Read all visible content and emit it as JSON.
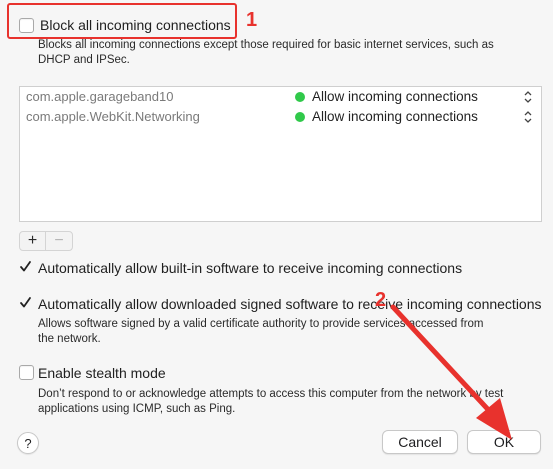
{
  "block_incoming": {
    "label": "Block all incoming connections",
    "checked": false,
    "description_line1": "Blocks all incoming connections except those required for basic internet services, such as",
    "description_line2": "DHCP and IPSec."
  },
  "annotations": {
    "marker1": "1",
    "marker2": "2",
    "color": "#e8322d"
  },
  "apps": [
    {
      "name": "com.apple.garageband10",
      "status": "Allow incoming connections",
      "status_color": "#30c94a",
      "stepper": "⌃⌄"
    },
    {
      "name": "com.apple.WebKit.Networking",
      "status": "Allow incoming connections",
      "status_color": "#30c94a",
      "stepper": "⌃⌄"
    }
  ],
  "list_controls": {
    "add": "+",
    "remove": "−"
  },
  "auto_builtin": {
    "label": "Automatically allow built-in software to receive incoming connections",
    "checked": true
  },
  "auto_signed": {
    "label": "Automatically allow downloaded signed software to receive incoming connections",
    "checked": true,
    "description_line1": "Allows software signed by a valid certificate authority to provide services accessed from",
    "description_line2": "the network."
  },
  "stealth": {
    "label": "Enable stealth mode",
    "checked": false,
    "description_line1": "Don’t respond to or acknowledge attempts to access this computer from the network by test",
    "description_line2": "applications using ICMP, such as Ping."
  },
  "footer": {
    "help": "?",
    "cancel": "Cancel",
    "ok": "OK"
  }
}
